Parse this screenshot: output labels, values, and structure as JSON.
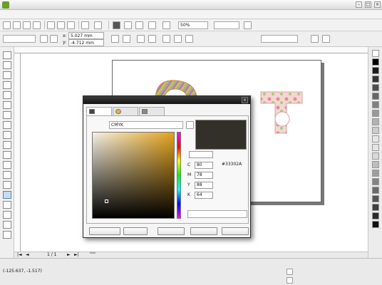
{
  "app": {
    "title": ""
  },
  "menu": [
    "",
    "",
    "",
    "",
    "",
    "",
    "",
    "",
    "",
    "",
    "",
    ""
  ],
  "toolbar": {
    "zoom": "50%",
    "snap": ""
  },
  "propbar": {
    "page_size": "",
    "x": "5.027 mm",
    "y": "-4.712 mm",
    "unit": ""
  },
  "dialog": {
    "title": "",
    "tabs": [
      "",
      "",
      ""
    ],
    "model_label": "",
    "model_value": "CMYK",
    "hex_label": "",
    "hex_value": "#33302A",
    "cmyk": {
      "C": "80",
      "M": "78",
      "Y": "88",
      "K": "64"
    },
    "color_name_label": "",
    "buttons": {
      "add_palette": "",
      "options": "",
      "ok": "",
      "cancel": "",
      "help": ""
    },
    "preview_color": "#33302A"
  },
  "docnav": {
    "page_count": "1 / 1",
    "page_tab": ""
  },
  "status": {
    "coords": "(-125.637, -1.517)",
    "hint": "",
    "hint2": "",
    "profile": "",
    "fill_label": "",
    "outline_label": ""
  },
  "canvas": {
    "side_text": [
      "",
      "",
      "",
      ""
    ],
    "side_small": ""
  }
}
